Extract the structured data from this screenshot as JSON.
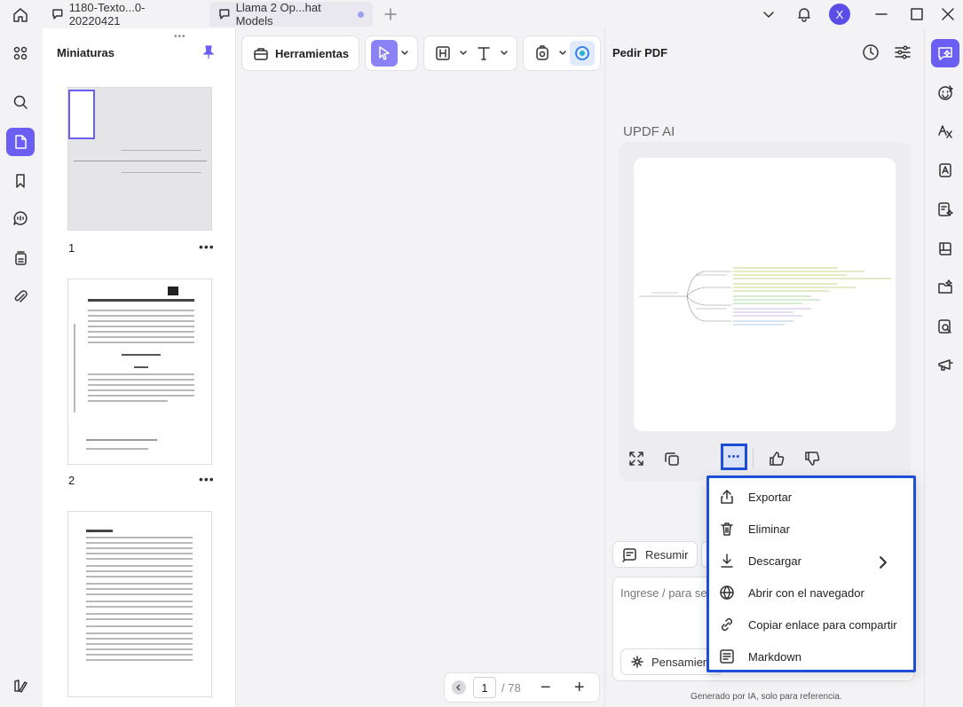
{
  "titlebar": {
    "tabs": [
      {
        "label": "1180-Texto...0-20220421"
      },
      {
        "label": "Llama 2 Op...hat Models"
      }
    ],
    "avatar_initial": "X"
  },
  "thumbnails": {
    "title": "Miniaturas",
    "grip": "•••",
    "pages": [
      {
        "number": "1"
      },
      {
        "number": "2"
      }
    ],
    "more": "•••"
  },
  "toolbar": {
    "tools_label": "Herramientas"
  },
  "pager": {
    "current": "1",
    "total": "/ 78",
    "zoom_out": "−",
    "zoom_in": "+"
  },
  "ai_panel": {
    "title": "Pedir PDF",
    "assistant_name": "UPDF AI",
    "more_dots": "•••",
    "summarize_label": "Resumir",
    "input_placeholder": "Ingrese / para sele",
    "thinking_label": "Pensamient",
    "footer_note": "Generado por IA, solo para referencia."
  },
  "context_menu": {
    "items": [
      {
        "label": "Exportar",
        "icon": "share-icon"
      },
      {
        "label": "Eliminar",
        "icon": "trash-icon"
      },
      {
        "label": "Descargar",
        "icon": "download-icon"
      },
      {
        "label": "Abrir con el navegador",
        "icon": "globe-icon"
      },
      {
        "label": "Copiar enlace para compartir",
        "icon": "link-icon"
      },
      {
        "label": "Markdown",
        "icon": "markdown-icon"
      }
    ]
  },
  "colors": {
    "accent": "#6a5ff2",
    "highlight_border": "#1c4fd6"
  }
}
